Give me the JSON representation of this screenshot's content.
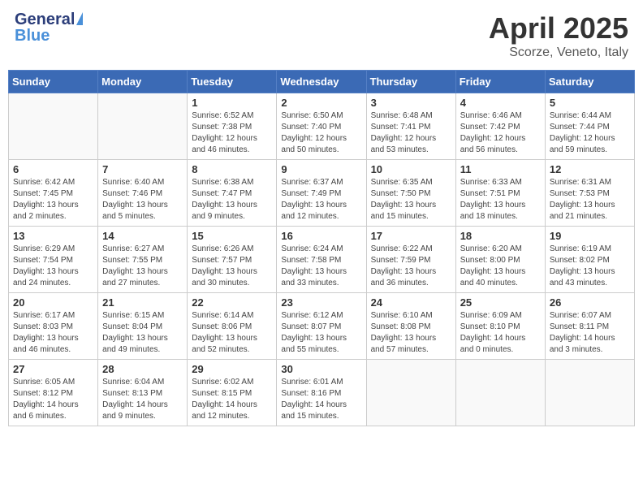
{
  "header": {
    "logo_general": "General",
    "logo_blue": "Blue",
    "title": "April 2025",
    "subtitle": "Scorze, Veneto, Italy"
  },
  "days_of_week": [
    "Sunday",
    "Monday",
    "Tuesday",
    "Wednesday",
    "Thursday",
    "Friday",
    "Saturday"
  ],
  "weeks": [
    [
      {
        "day": "",
        "info": ""
      },
      {
        "day": "",
        "info": ""
      },
      {
        "day": "1",
        "info": "Sunrise: 6:52 AM\nSunset: 7:38 PM\nDaylight: 12 hours and 46 minutes."
      },
      {
        "day": "2",
        "info": "Sunrise: 6:50 AM\nSunset: 7:40 PM\nDaylight: 12 hours and 50 minutes."
      },
      {
        "day": "3",
        "info": "Sunrise: 6:48 AM\nSunset: 7:41 PM\nDaylight: 12 hours and 53 minutes."
      },
      {
        "day": "4",
        "info": "Sunrise: 6:46 AM\nSunset: 7:42 PM\nDaylight: 12 hours and 56 minutes."
      },
      {
        "day": "5",
        "info": "Sunrise: 6:44 AM\nSunset: 7:44 PM\nDaylight: 12 hours and 59 minutes."
      }
    ],
    [
      {
        "day": "6",
        "info": "Sunrise: 6:42 AM\nSunset: 7:45 PM\nDaylight: 13 hours and 2 minutes."
      },
      {
        "day": "7",
        "info": "Sunrise: 6:40 AM\nSunset: 7:46 PM\nDaylight: 13 hours and 5 minutes."
      },
      {
        "day": "8",
        "info": "Sunrise: 6:38 AM\nSunset: 7:47 PM\nDaylight: 13 hours and 9 minutes."
      },
      {
        "day": "9",
        "info": "Sunrise: 6:37 AM\nSunset: 7:49 PM\nDaylight: 13 hours and 12 minutes."
      },
      {
        "day": "10",
        "info": "Sunrise: 6:35 AM\nSunset: 7:50 PM\nDaylight: 13 hours and 15 minutes."
      },
      {
        "day": "11",
        "info": "Sunrise: 6:33 AM\nSunset: 7:51 PM\nDaylight: 13 hours and 18 minutes."
      },
      {
        "day": "12",
        "info": "Sunrise: 6:31 AM\nSunset: 7:53 PM\nDaylight: 13 hours and 21 minutes."
      }
    ],
    [
      {
        "day": "13",
        "info": "Sunrise: 6:29 AM\nSunset: 7:54 PM\nDaylight: 13 hours and 24 minutes."
      },
      {
        "day": "14",
        "info": "Sunrise: 6:27 AM\nSunset: 7:55 PM\nDaylight: 13 hours and 27 minutes."
      },
      {
        "day": "15",
        "info": "Sunrise: 6:26 AM\nSunset: 7:57 PM\nDaylight: 13 hours and 30 minutes."
      },
      {
        "day": "16",
        "info": "Sunrise: 6:24 AM\nSunset: 7:58 PM\nDaylight: 13 hours and 33 minutes."
      },
      {
        "day": "17",
        "info": "Sunrise: 6:22 AM\nSunset: 7:59 PM\nDaylight: 13 hours and 36 minutes."
      },
      {
        "day": "18",
        "info": "Sunrise: 6:20 AM\nSunset: 8:00 PM\nDaylight: 13 hours and 40 minutes."
      },
      {
        "day": "19",
        "info": "Sunrise: 6:19 AM\nSunset: 8:02 PM\nDaylight: 13 hours and 43 minutes."
      }
    ],
    [
      {
        "day": "20",
        "info": "Sunrise: 6:17 AM\nSunset: 8:03 PM\nDaylight: 13 hours and 46 minutes."
      },
      {
        "day": "21",
        "info": "Sunrise: 6:15 AM\nSunset: 8:04 PM\nDaylight: 13 hours and 49 minutes."
      },
      {
        "day": "22",
        "info": "Sunrise: 6:14 AM\nSunset: 8:06 PM\nDaylight: 13 hours and 52 minutes."
      },
      {
        "day": "23",
        "info": "Sunrise: 6:12 AM\nSunset: 8:07 PM\nDaylight: 13 hours and 55 minutes."
      },
      {
        "day": "24",
        "info": "Sunrise: 6:10 AM\nSunset: 8:08 PM\nDaylight: 13 hours and 57 minutes."
      },
      {
        "day": "25",
        "info": "Sunrise: 6:09 AM\nSunset: 8:10 PM\nDaylight: 14 hours and 0 minutes."
      },
      {
        "day": "26",
        "info": "Sunrise: 6:07 AM\nSunset: 8:11 PM\nDaylight: 14 hours and 3 minutes."
      }
    ],
    [
      {
        "day": "27",
        "info": "Sunrise: 6:05 AM\nSunset: 8:12 PM\nDaylight: 14 hours and 6 minutes."
      },
      {
        "day": "28",
        "info": "Sunrise: 6:04 AM\nSunset: 8:13 PM\nDaylight: 14 hours and 9 minutes."
      },
      {
        "day": "29",
        "info": "Sunrise: 6:02 AM\nSunset: 8:15 PM\nDaylight: 14 hours and 12 minutes."
      },
      {
        "day": "30",
        "info": "Sunrise: 6:01 AM\nSunset: 8:16 PM\nDaylight: 14 hours and 15 minutes."
      },
      {
        "day": "",
        "info": ""
      },
      {
        "day": "",
        "info": ""
      },
      {
        "day": "",
        "info": ""
      }
    ]
  ]
}
